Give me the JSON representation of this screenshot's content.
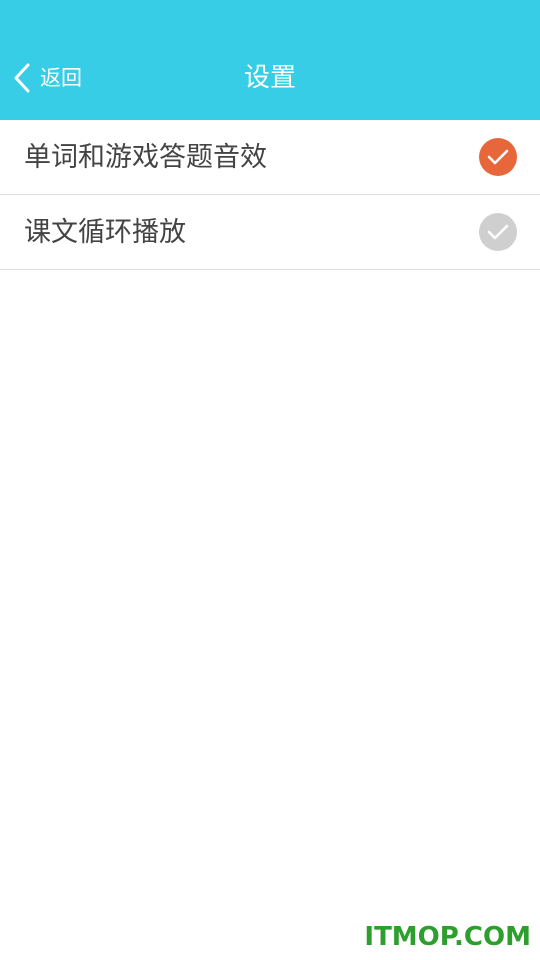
{
  "header": {
    "back_label": "返回",
    "title": "设置",
    "background_color": "#38cde6"
  },
  "settings": [
    {
      "label": "单词和游戏答题音效",
      "checked": true,
      "icon": "check-circle-icon"
    },
    {
      "label": "课文循环播放",
      "checked": false,
      "icon": "check-circle-icon"
    }
  ],
  "colors": {
    "checked": "#e8673a",
    "unchecked": "#cfcfcf",
    "text": "#444444",
    "divider": "#dcdcdc"
  },
  "watermark": "ITMOP.COM"
}
